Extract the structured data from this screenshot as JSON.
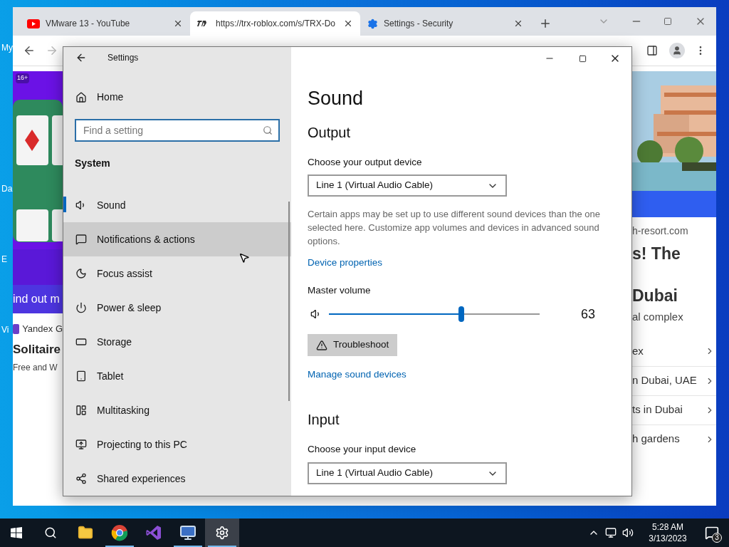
{
  "desktop": {
    "icon_labels": [
      "My",
      "Da",
      "E",
      "Vi"
    ]
  },
  "browser": {
    "tabs": [
      {
        "title": "VMware 13 - YouTube",
        "selected": false
      },
      {
        "title": "https://trx-roblox.com/s/TRX-Do",
        "selected": true
      },
      {
        "title": "Settings - Security",
        "selected": false
      }
    ],
    "left_ad": {
      "badge": "16+",
      "button": "ind out m",
      "source": "Yandex G",
      "headline": "Solitaire",
      "subline": "Free and W"
    },
    "right_ad": {
      "domain": "h-resort.com",
      "headline_1": "s! The",
      "headline_2": "Dubai",
      "subline": "al complex",
      "links": [
        "ex",
        "n Dubai, UAE",
        "ts in Dubai",
        "h gardens"
      ]
    }
  },
  "settings": {
    "window_title": "Settings",
    "home": "Home",
    "search": {
      "placeholder": "Find a setting"
    },
    "section": "System",
    "nav": [
      {
        "label": "Sound",
        "selected": true,
        "hovered": false
      },
      {
        "label": "Notifications & actions",
        "selected": false,
        "hovered": true
      },
      {
        "label": "Focus assist",
        "selected": false,
        "hovered": false
      },
      {
        "label": "Power & sleep",
        "selected": false,
        "hovered": false
      },
      {
        "label": "Storage",
        "selected": false,
        "hovered": false
      },
      {
        "label": "Tablet",
        "selected": false,
        "hovered": false
      },
      {
        "label": "Multitasking",
        "selected": false,
        "hovered": false
      },
      {
        "label": "Projecting to this PC",
        "selected": false,
        "hovered": false
      },
      {
        "label": "Shared experiences",
        "selected": false,
        "hovered": false
      }
    ],
    "page_title": "Sound",
    "output_heading": "Output",
    "output_label": "Choose your output device",
    "output_device": "Line 1 (Virtual Audio Cable)",
    "output_note": "Certain apps may be set up to use different sound devices than the one selected here. Customize app volumes and devices in advanced sound options.",
    "device_properties": "Device properties",
    "volume_label": "Master volume",
    "volume": {
      "level": 0.63,
      "reading": "63"
    },
    "troubleshoot": "Troubleshoot",
    "manage_devices": "Manage sound devices",
    "input_heading": "Input",
    "input_label": "Choose your input device",
    "input_device": "Line 1 (Virtual Audio Cable)"
  },
  "taskbar": {
    "apps": [
      {
        "open": false,
        "active": false
      },
      {
        "open": true,
        "active": false
      },
      {
        "open": false,
        "active": false
      },
      {
        "open": true,
        "active": false
      },
      {
        "open": true,
        "active": true
      }
    ],
    "time": "5:28 AM",
    "date": "3/13/2023",
    "notifications": "3"
  }
}
